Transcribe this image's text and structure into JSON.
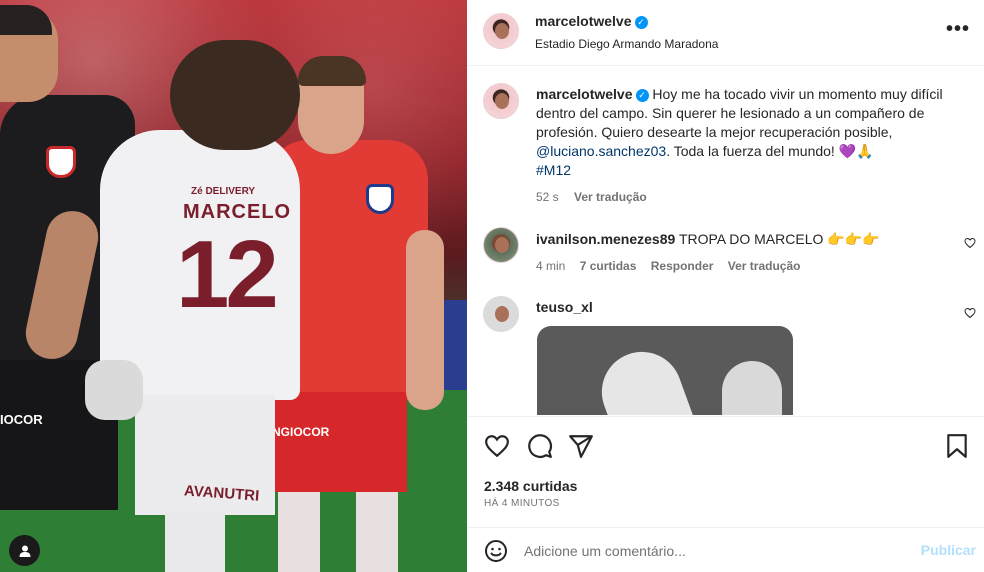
{
  "post": {
    "author": "marcelotwelve",
    "location": "Estadio Diego Armando Maradona",
    "more_icon": "more-horizontal-icon"
  },
  "photo": {
    "jersey_sponsor": "Zé DELIVERY",
    "jersey_name": "MARCELO",
    "jersey_number": "12",
    "shorts_text": "AVANUTRI",
    "red_shorts_text": "NGIOCOR",
    "keeper_shorts_text": "IOCOR",
    "user_tag_icon": "user-icon"
  },
  "caption": {
    "username": "marcelotwelve",
    "text_before_mention": "Hoy me ha tocado vivir un momento muy difícil dentro del campo. Sin querer he lesionado a un compañero de profesión. Quiero desearte la mejor recuperación posible, ",
    "mention": "@luciano.sanchez03",
    "text_after_mention": ". Toda la fuerza del mundo! 💜🙏",
    "hashtag": "#M12",
    "time": "52 s",
    "translate": "Ver tradução"
  },
  "comments": [
    {
      "username": "ivanilson.menezes89",
      "text": "TROPA DO MARCELO 👉👉👉",
      "time": "4 min",
      "likes": "7 curtidas",
      "reply": "Responder",
      "translate": "Ver tradução"
    },
    {
      "username": "teuso_xl"
    }
  ],
  "actions": {
    "like_icon": "heart-icon",
    "comment_icon": "comment-icon",
    "share_icon": "send-icon",
    "save_icon": "bookmark-icon",
    "likes": "2.348 curtidas",
    "time_ago": "HÁ 4 MINUTOS"
  },
  "add_comment": {
    "emoji_icon": "emoji-icon",
    "placeholder": "Adicione um comentário...",
    "publish": "Publicar"
  },
  "colors": {
    "accent": "#0095f6",
    "link": "#00376b",
    "muted": "#737373",
    "publish_disabled": "#b2dffc"
  }
}
